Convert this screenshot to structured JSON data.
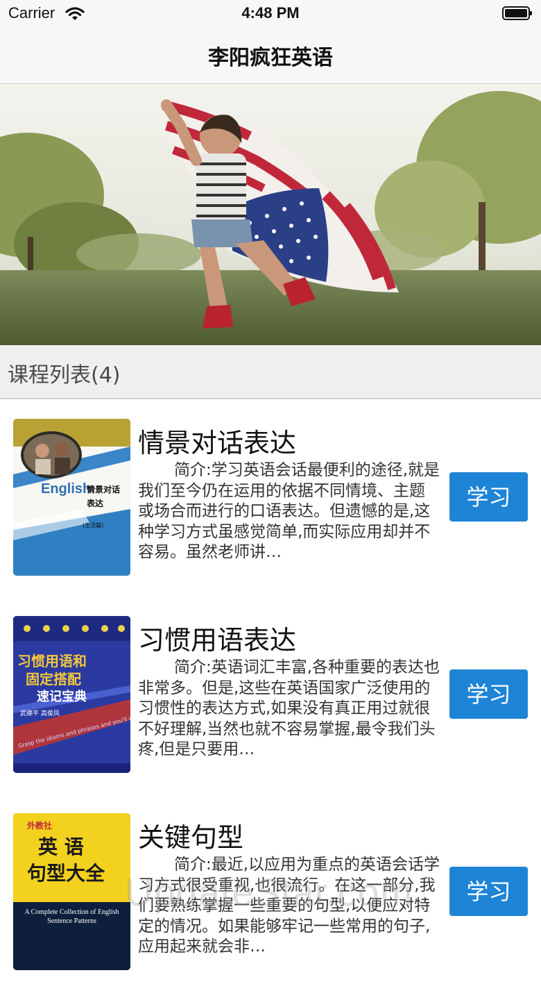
{
  "status_bar": {
    "carrier": "Carrier",
    "time": "4:48 PM"
  },
  "nav": {
    "title": "李阳疯狂英语"
  },
  "section": {
    "title": "课程列表(4)"
  },
  "courses": [
    {
      "title": "情景对话表达",
      "description": "简介:学习英语会话最便利的途径,就是我们至今仍在运用的依据不同情境、主题或场合而进行的口语表达。但遗憾的是,这种学习方式虽感觉简单,而实际应用却并不容易。虽然老师讲…",
      "button": "学习",
      "cover": {
        "brand": "English",
        "title_lines": [
          "情景对话",
          "表达"
        ],
        "subtitle": "(生活篇)"
      }
    },
    {
      "title": "习惯用语表达",
      "description": "简介:英语词汇丰富,各种重要的表达也非常多。但是,这些在英语国家广泛使用的习惯性的表达方式,如果没有真正用过就很不好理解,当然也就不容易掌握,最令我们头疼,但是只要用…",
      "button": "学习",
      "cover": {
        "title_lines": [
          "习惯用语和",
          "固定搭配",
          "速记宝典"
        ],
        "authors": "武德平  高俊凤",
        "english": "Grasp the idioms and phrases and you'll win."
      }
    },
    {
      "title": "关键句型",
      "description": "简介:最近,以应用为重点的英语会话学习方式很受重视,也很流行。在这一部分,我们要熟练掌握一些重要的句型,以便应对特定的情况。如果能够牢记一些常用的句子,应用起来就会非…",
      "button": "学习",
      "cover": {
        "publisher": "外教社",
        "title_lines": [
          "英  语",
          "句型大全"
        ],
        "english": "A Complete Collection of English Sentence Patterns"
      }
    }
  ],
  "watermark": "UpdateStar.com",
  "colors": {
    "accent": "#1e84d6",
    "nav_bg": "#f7f7f7",
    "section_bg": "#efefef"
  },
  "icons": [
    "wifi-icon",
    "battery-icon"
  ]
}
